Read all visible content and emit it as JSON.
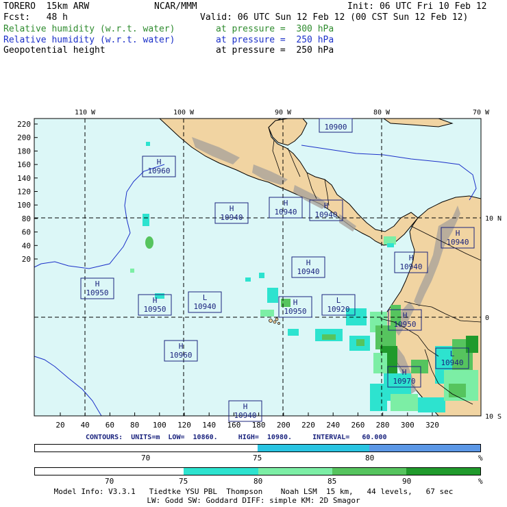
{
  "header": {
    "model": "TORERO  15km ARW",
    "center": "NCAR/MMM",
    "init": "Init: 06 UTC Fri 10 Feb 12",
    "fcst": "Fcst:   48 h",
    "valid": "Valid: 06 UTC Sun 12 Feb 12 (00 CST Sun 12 Feb 12)",
    "fields": [
      {
        "name": "Relative humidity (w.r.t. water)",
        "level": "at pressure =  300 hPa",
        "color": "#2e8b2e"
      },
      {
        "name": "Relative humidity (w.r.t. water)",
        "level": "at pressure =  250 hPa",
        "color": "#1a2fc8"
      },
      {
        "name": "Geopotential height",
        "level": "at pressure =  250 hPa",
        "color": "#000000"
      }
    ]
  },
  "map": {
    "top_labels": [
      "110 W",
      "100 W",
      "90 W",
      "80 W",
      "70 W"
    ],
    "right_labels": [
      "10 N",
      "0",
      "10 S"
    ],
    "x_ticks": [
      "20",
      "40",
      "60",
      "80",
      "100",
      "120",
      "140",
      "160",
      "180",
      "200",
      "220",
      "240",
      "260",
      "280",
      "300",
      "320"
    ],
    "y_ticks": [
      "220",
      "200",
      "180",
      "160",
      "140",
      "120",
      "100",
      "80",
      "60",
      "40",
      "20"
    ],
    "centers": [
      {
        "type": "H",
        "value": "10960"
      },
      {
        "type": "H",
        "value": "10940"
      },
      {
        "type": "H",
        "value": "10940"
      },
      {
        "type": "H",
        "value": "10940"
      },
      {
        "type": "H",
        "value": "10940"
      },
      {
        "type": "H",
        "value": "10940"
      },
      {
        "type": "H",
        "value": "10940"
      },
      {
        "type": "H",
        "value": "10950"
      },
      {
        "type": "H",
        "value": "10950"
      },
      {
        "type": "L",
        "value": "10940"
      },
      {
        "type": "H",
        "value": "10950"
      },
      {
        "type": "L",
        "value": "10920"
      },
      {
        "type": "H",
        "value": "10950"
      },
      {
        "type": "H",
        "value": "10960"
      },
      {
        "type": "H",
        "value": "10970"
      },
      {
        "type": "L",
        "value": "10940"
      },
      {
        "type": "H",
        "value": "10940"
      },
      {
        "type": "",
        "value": "10900"
      }
    ],
    "colors": {
      "ocean": "#dcf7f7",
      "land": "#f1d4a2"
    }
  },
  "contours": "CONTOURS:  UNITS=m  LOW=  10860.     HIGH=  10980.     INTERVAL=   60.000",
  "colorbar1": {
    "labels": [
      "70",
      "75",
      "80",
      "%"
    ],
    "colors": [
      "#ffffff",
      "#29c4e2",
      "#5b97e6"
    ]
  },
  "colorbar2": {
    "labels": [
      "70",
      "75",
      "80",
      "85",
      "90",
      "%"
    ],
    "colors": [
      "#ffffff",
      "#ffffff",
      "#2de3cf",
      "#7ceea5",
      "#56c45e",
      "#209a2c"
    ]
  },
  "footer": {
    "line1": "Model Info: V3.3.1   Tiedtke YSU PBL  Thompson    Noah LSM  15 km,   44 levels,   67 sec",
    "line2": "LW: Godd SW: Goddard DIFF: simple KM: 2D Smagor"
  }
}
